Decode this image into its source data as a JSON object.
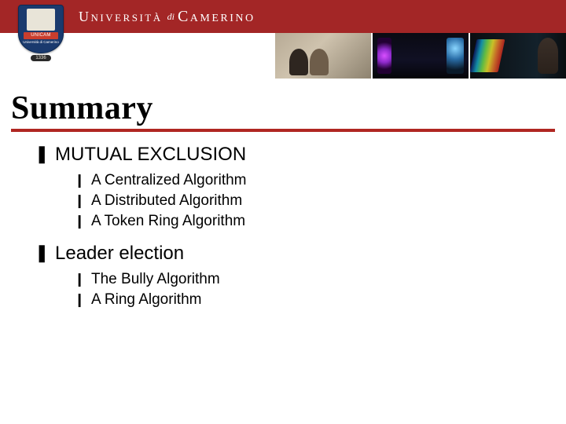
{
  "header": {
    "crest_band": "UNICAM",
    "crest_sub": "Università di Camerino",
    "crest_year": "1336",
    "university_word1": "Università",
    "university_di": "di",
    "university_word2": "Camerino"
  },
  "title": "Summary",
  "bullets": {
    "lvl1_symbol": "❚",
    "lvl2_symbol": "❙"
  },
  "outline": [
    {
      "label": "MUTUAL EXCLUSION",
      "items": [
        "A Centralized Algorithm",
        "A Distributed Algorithm",
        "A Token Ring Algorithm"
      ]
    },
    {
      "label": "Leader election",
      "items": [
        "The Bully Algorithm",
        "A Ring Algorithm"
      ]
    }
  ]
}
